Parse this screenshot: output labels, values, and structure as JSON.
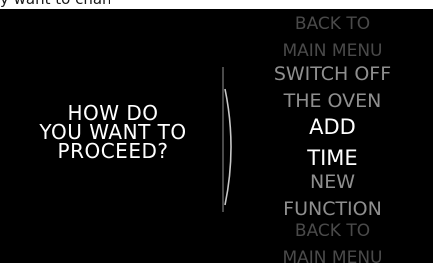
{
  "screen": {
    "caption": "y want to change",
    "prompt": {
      "line1": "HOW DO",
      "line2": "YOU WANT TO",
      "line3": "PROCEED?"
    },
    "menu": {
      "items": [
        {
          "line1": "BACK TO",
          "line2": "MAIN MENU"
        },
        {
          "line1": "SWITCH OFF",
          "line2": "THE OVEN"
        },
        {
          "line1": "ADD",
          "line2": "TIME"
        },
        {
          "line1": "NEW",
          "line2": "FUNCTION"
        },
        {
          "line1": "BACK TO",
          "line2": "MAIN MENU"
        }
      ],
      "selected_index": 2
    }
  },
  "colors": {
    "background": "#000000",
    "text_active": "#ffffff",
    "text_near": "#8f8f8f",
    "text_far": "#4a4a4a"
  }
}
